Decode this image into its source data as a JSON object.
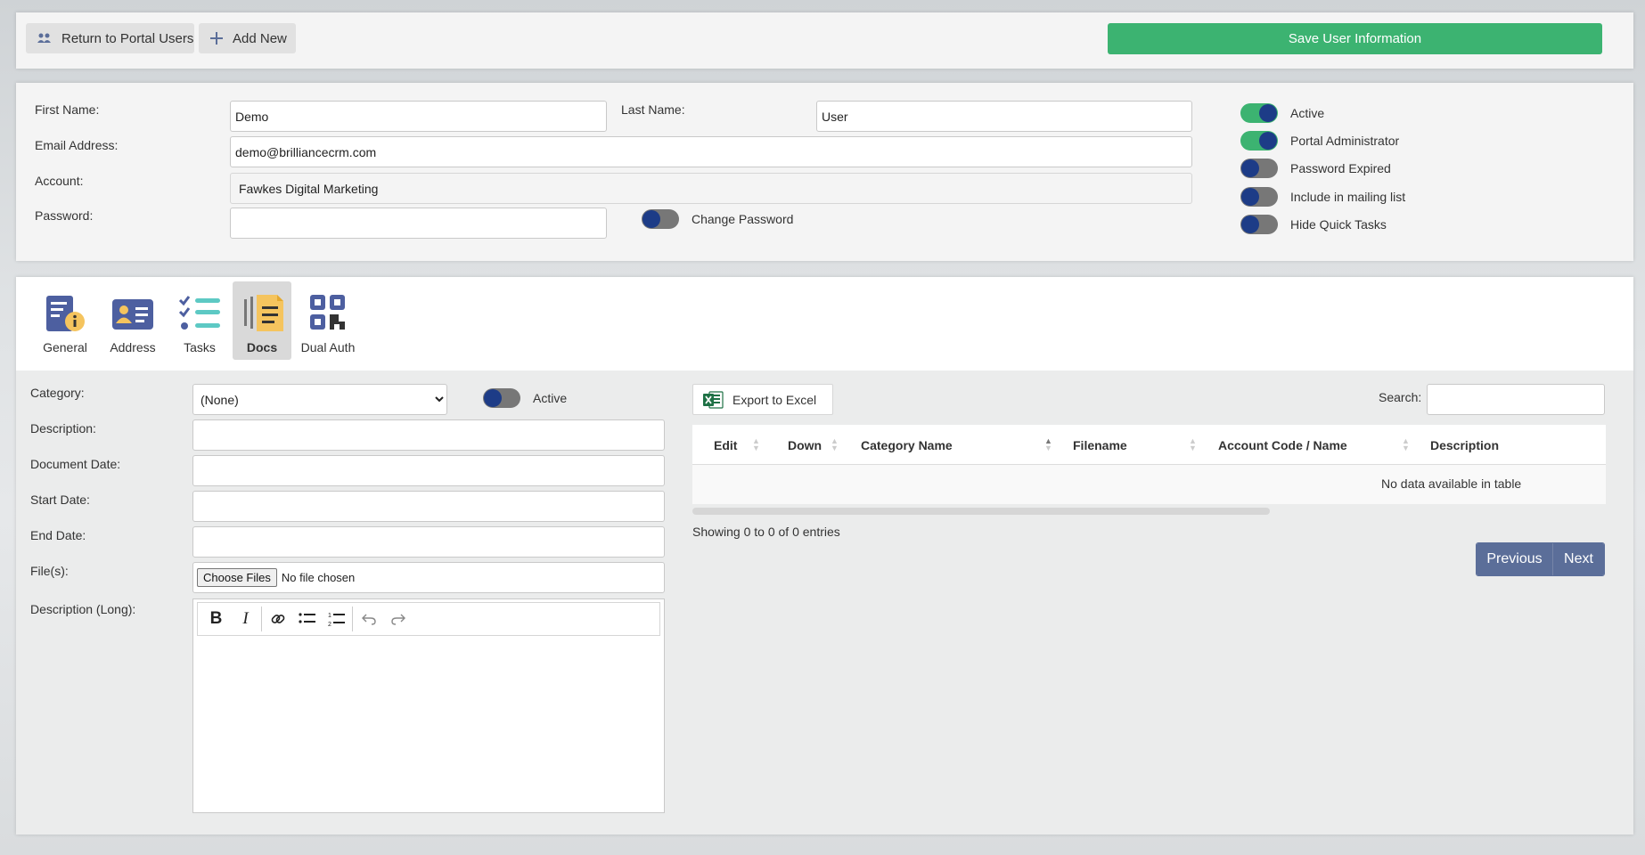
{
  "toolbar": {
    "return_label": "Return to Portal Users",
    "return_icon": "users-icon",
    "addnew_label": "Add New",
    "addnew_icon": "plus-icon",
    "save_label": "Save User Information",
    "save_color": "#3cb371"
  },
  "user": {
    "first_name_label": "First Name:",
    "first_name": "Demo",
    "last_name_label": "Last Name:",
    "last_name": "User",
    "email_label": "Email Address:",
    "email": "demo@brilliancecrm.com",
    "account_label": "Account:",
    "account": "Fawkes Digital Marketing",
    "password_label": "Password:",
    "password": "",
    "change_password_label": "Change Password",
    "change_password_on": false
  },
  "flags": [
    {
      "label": "Active",
      "on": true
    },
    {
      "label": "Portal Administrator",
      "on": true
    },
    {
      "label": "Password Expired",
      "on": false
    },
    {
      "label": "Include in mailing list",
      "on": false
    },
    {
      "label": "Hide Quick Tasks",
      "on": false
    }
  ],
  "tabs": [
    {
      "label": "General",
      "icon": "general-info-icon",
      "selected": false
    },
    {
      "label": "Address",
      "icon": "address-card-icon",
      "selected": false
    },
    {
      "label": "Tasks",
      "icon": "checklist-icon",
      "selected": false
    },
    {
      "label": "Docs",
      "icon": "document-icon",
      "selected": true
    },
    {
      "label": "Dual Auth",
      "icon": "qr-code-icon",
      "selected": false
    }
  ],
  "docform": {
    "category_label": "Category:",
    "category_value": "(None)",
    "active_label": "Active",
    "active_on": false,
    "description_label": "Description:",
    "document_date_label": "Document Date:",
    "start_date_label": "Start Date:",
    "end_date_label": "End Date:",
    "files_label": "File(s):",
    "choose_files_label": "Choose Files",
    "no_file_label": "No file chosen",
    "long_desc_label": "Description (Long):"
  },
  "grid": {
    "export_label": "Export to Excel",
    "export_icon": "excel-icon",
    "search_label": "Search:",
    "columns": [
      "Edit",
      "Down",
      "Category Name",
      "Filename",
      "Account Code / Name",
      "Description"
    ],
    "empty_message": "No data available in table",
    "info": "Showing 0 to 0 of 0 entries",
    "prev_label": "Previous",
    "next_label": "Next"
  }
}
